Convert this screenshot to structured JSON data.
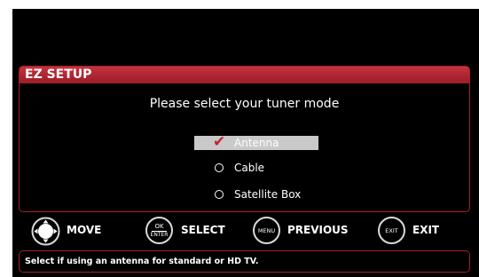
{
  "panel": {
    "title": "EZ SETUP",
    "prompt": "Please select your tuner mode"
  },
  "options": [
    {
      "label": "Antenna",
      "selected": true
    },
    {
      "label": "Cable",
      "selected": false
    },
    {
      "label": "Satellite Box",
      "selected": false
    }
  ],
  "hints": {
    "move": {
      "label": "MOVE",
      "icon": "dpad-icon"
    },
    "select": {
      "label": "SELECT",
      "key_top": "OK",
      "key_bottom": "ENTER"
    },
    "previous": {
      "label": "PREVIOUS",
      "key": "MENU"
    },
    "exit": {
      "label": "EXIT",
      "key": "EXIT"
    }
  },
  "status": "Select if using an antenna for standard or HD TV.",
  "colors": {
    "accent": "#b52632",
    "background": "#000000",
    "selected_row": "#c9c9c9",
    "check": "#c4232f"
  }
}
